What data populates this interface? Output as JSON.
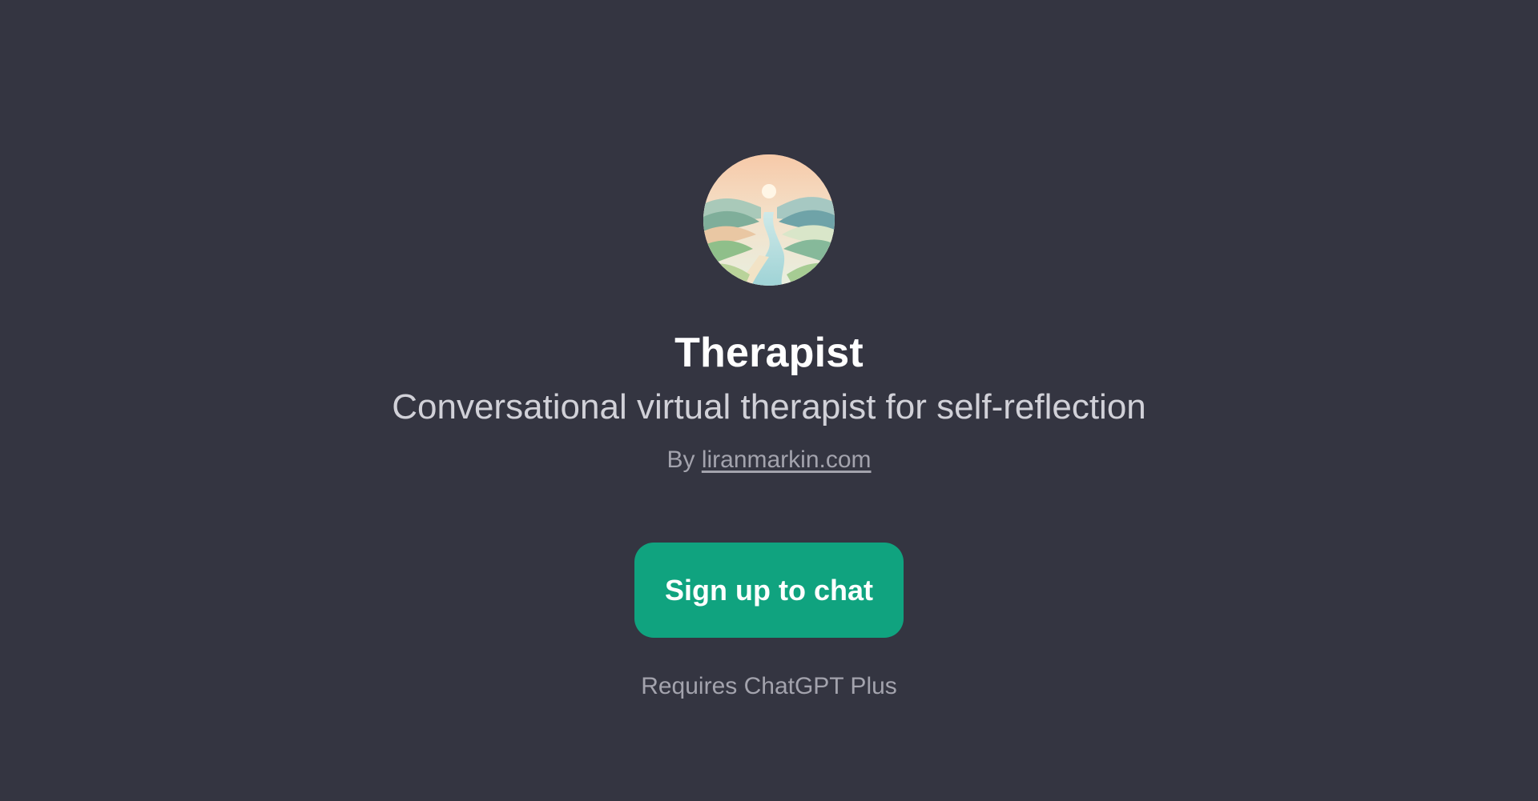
{
  "gpt": {
    "title": "Therapist",
    "description": "Conversational virtual therapist for self-reflection",
    "byline_prefix": "By ",
    "author": "liranmarkin.com",
    "avatar_icon": "landscape-avatar-icon"
  },
  "actions": {
    "signup_label": "Sign up to chat"
  },
  "footer": {
    "requirement": "Requires ChatGPT Plus"
  },
  "colors": {
    "background": "#343541",
    "accent": "#10a37f",
    "title": "#ffffff",
    "muted": "#a3a3ad"
  }
}
